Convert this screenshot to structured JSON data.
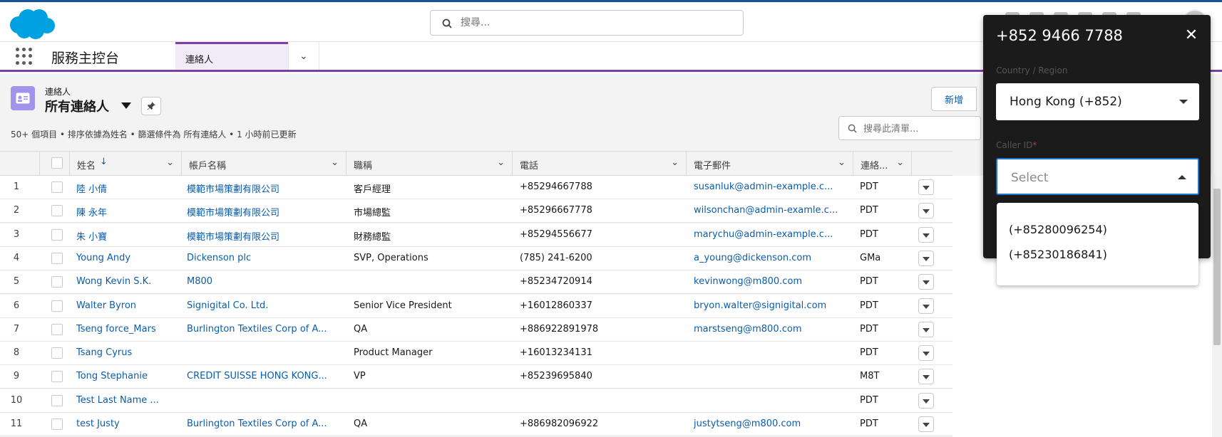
{
  "header": {
    "search_placeholder": "搜尋..."
  },
  "nav": {
    "app_name": "服務主控台",
    "tab_label": "連絡人"
  },
  "list_header": {
    "object_label": "連絡人",
    "list_view_name": "所有連絡人",
    "meta": "50+ 個項目 • 排序依據為姓名 • 篩選條件為 所有連絡人 • 1 小時前已更新",
    "new_button": "新增",
    "search_placeholder": "搜尋此清單..."
  },
  "table": {
    "columns": [
      "姓名",
      "帳戶名稱",
      "職稱",
      "電話",
      "電子郵件",
      "連絡..."
    ],
    "sort_indicator": "↓",
    "rows": [
      {
        "num": "1",
        "name": "陸 小倩",
        "account": "模範市場策劃有限公司",
        "title": "客戶經理",
        "phone": "+85294667788",
        "email": "susanluk@admin-example.c...",
        "tz": "PDT"
      },
      {
        "num": "2",
        "name": "陳 永年",
        "account": "模範市場策劃有限公司",
        "title": "市場總監",
        "phone": "+85296667778",
        "email": "wilsonchan@admin-examle.c...",
        "tz": "PDT"
      },
      {
        "num": "3",
        "name": "朱 小寶",
        "account": "模範市場策劃有限公司",
        "title": "財務總監",
        "phone": "+85294556677",
        "email": "marychu@admin-example.c...",
        "tz": "PDT"
      },
      {
        "num": "4",
        "name": "Young Andy",
        "account": "Dickenson plc",
        "title": "SVP, Operations",
        "phone": "(785) 241-6200",
        "email": "a_young@dickenson.com",
        "tz": "GMa"
      },
      {
        "num": "5",
        "name": "Wong Kevin S.K.",
        "account": "M800",
        "title": "",
        "phone": "+85234720914",
        "email": "kevinwong@m800.com",
        "tz": "PDT"
      },
      {
        "num": "6",
        "name": "Walter Byron",
        "account": "Signigital Co. Ltd.",
        "title": "Senior Vice President",
        "phone": "+16012860337",
        "email": "bryon.walter@signigital.com",
        "tz": "PDT"
      },
      {
        "num": "7",
        "name": "Tseng force_Mars",
        "account": "Burlington Textiles Corp of A...",
        "title": "QA",
        "phone": "+886922891978",
        "email": "marstseng@m800.com",
        "tz": "PDT"
      },
      {
        "num": "8",
        "name": "Tsang Cyrus",
        "account": "",
        "title": "Product Manager",
        "phone": "+16013234131",
        "email": "",
        "tz": "PDT"
      },
      {
        "num": "9",
        "name": "Tong Stephanie",
        "account": "CREDIT SUISSE HONG KONG...",
        "title": "VP",
        "phone": "+85239695840",
        "email": "",
        "tz": "M8T"
      },
      {
        "num": "10",
        "name": "Test Last Name ...",
        "account": "",
        "title": "",
        "phone": "",
        "email": "",
        "tz": "PDT"
      },
      {
        "num": "11",
        "name": "test Justy",
        "account": "Burlington Textiles Corp of A...",
        "title": "QA",
        "phone": "+886982096922",
        "email": "justytseng@m800.com",
        "tz": "PDT"
      }
    ]
  },
  "phone_panel": {
    "number": "+852 9466 7788",
    "country_label": "Country / Region",
    "country_value": "Hong Kong (+852)",
    "caller_id_label": "Caller ID",
    "required_mark": "*",
    "caller_id_placeholder": "Select",
    "options": [
      "(+85280096254)",
      "(+85230186841)"
    ]
  },
  "colors": {
    "brand_blue": "#00a1e0",
    "link": "#0b5cab",
    "nav_accent": "#7f3fa0",
    "focus": "#1b76d3"
  }
}
